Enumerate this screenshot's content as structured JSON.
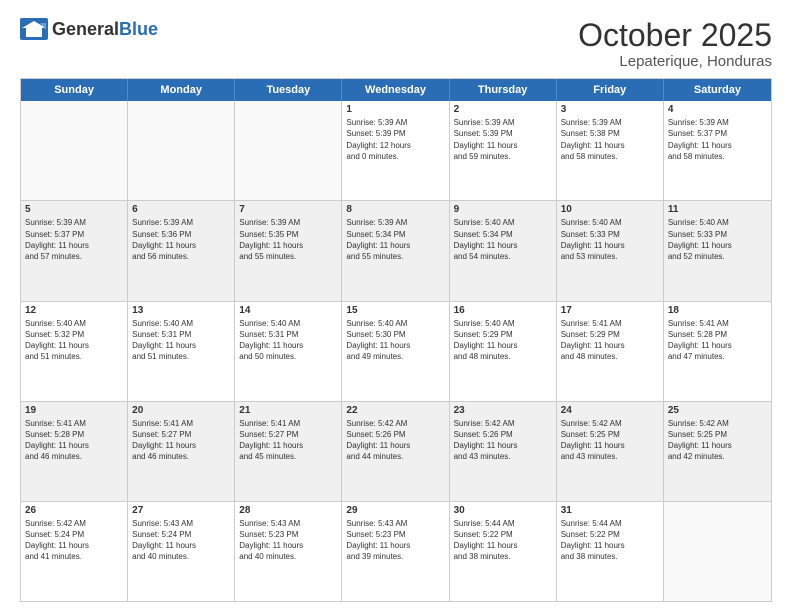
{
  "header": {
    "logo_general": "General",
    "logo_blue": "Blue",
    "month": "October 2025",
    "location": "Lepaterique, Honduras"
  },
  "weekdays": [
    "Sunday",
    "Monday",
    "Tuesday",
    "Wednesday",
    "Thursday",
    "Friday",
    "Saturday"
  ],
  "rows": [
    [
      {
        "day": "",
        "info": ""
      },
      {
        "day": "",
        "info": ""
      },
      {
        "day": "",
        "info": ""
      },
      {
        "day": "1",
        "info": "Sunrise: 5:39 AM\nSunset: 5:39 PM\nDaylight: 12 hours\nand 0 minutes."
      },
      {
        "day": "2",
        "info": "Sunrise: 5:39 AM\nSunset: 5:39 PM\nDaylight: 11 hours\nand 59 minutes."
      },
      {
        "day": "3",
        "info": "Sunrise: 5:39 AM\nSunset: 5:38 PM\nDaylight: 11 hours\nand 58 minutes."
      },
      {
        "day": "4",
        "info": "Sunrise: 5:39 AM\nSunset: 5:37 PM\nDaylight: 11 hours\nand 58 minutes."
      }
    ],
    [
      {
        "day": "5",
        "info": "Sunrise: 5:39 AM\nSunset: 5:37 PM\nDaylight: 11 hours\nand 57 minutes."
      },
      {
        "day": "6",
        "info": "Sunrise: 5:39 AM\nSunset: 5:36 PM\nDaylight: 11 hours\nand 56 minutes."
      },
      {
        "day": "7",
        "info": "Sunrise: 5:39 AM\nSunset: 5:35 PM\nDaylight: 11 hours\nand 55 minutes."
      },
      {
        "day": "8",
        "info": "Sunrise: 5:39 AM\nSunset: 5:34 PM\nDaylight: 11 hours\nand 55 minutes."
      },
      {
        "day": "9",
        "info": "Sunrise: 5:40 AM\nSunset: 5:34 PM\nDaylight: 11 hours\nand 54 minutes."
      },
      {
        "day": "10",
        "info": "Sunrise: 5:40 AM\nSunset: 5:33 PM\nDaylight: 11 hours\nand 53 minutes."
      },
      {
        "day": "11",
        "info": "Sunrise: 5:40 AM\nSunset: 5:33 PM\nDaylight: 11 hours\nand 52 minutes."
      }
    ],
    [
      {
        "day": "12",
        "info": "Sunrise: 5:40 AM\nSunset: 5:32 PM\nDaylight: 11 hours\nand 51 minutes."
      },
      {
        "day": "13",
        "info": "Sunrise: 5:40 AM\nSunset: 5:31 PM\nDaylight: 11 hours\nand 51 minutes."
      },
      {
        "day": "14",
        "info": "Sunrise: 5:40 AM\nSunset: 5:31 PM\nDaylight: 11 hours\nand 50 minutes."
      },
      {
        "day": "15",
        "info": "Sunrise: 5:40 AM\nSunset: 5:30 PM\nDaylight: 11 hours\nand 49 minutes."
      },
      {
        "day": "16",
        "info": "Sunrise: 5:40 AM\nSunset: 5:29 PM\nDaylight: 11 hours\nand 48 minutes."
      },
      {
        "day": "17",
        "info": "Sunrise: 5:41 AM\nSunset: 5:29 PM\nDaylight: 11 hours\nand 48 minutes."
      },
      {
        "day": "18",
        "info": "Sunrise: 5:41 AM\nSunset: 5:28 PM\nDaylight: 11 hours\nand 47 minutes."
      }
    ],
    [
      {
        "day": "19",
        "info": "Sunrise: 5:41 AM\nSunset: 5:28 PM\nDaylight: 11 hours\nand 46 minutes."
      },
      {
        "day": "20",
        "info": "Sunrise: 5:41 AM\nSunset: 5:27 PM\nDaylight: 11 hours\nand 46 minutes."
      },
      {
        "day": "21",
        "info": "Sunrise: 5:41 AM\nSunset: 5:27 PM\nDaylight: 11 hours\nand 45 minutes."
      },
      {
        "day": "22",
        "info": "Sunrise: 5:42 AM\nSunset: 5:26 PM\nDaylight: 11 hours\nand 44 minutes."
      },
      {
        "day": "23",
        "info": "Sunrise: 5:42 AM\nSunset: 5:26 PM\nDaylight: 11 hours\nand 43 minutes."
      },
      {
        "day": "24",
        "info": "Sunrise: 5:42 AM\nSunset: 5:25 PM\nDaylight: 11 hours\nand 43 minutes."
      },
      {
        "day": "25",
        "info": "Sunrise: 5:42 AM\nSunset: 5:25 PM\nDaylight: 11 hours\nand 42 minutes."
      }
    ],
    [
      {
        "day": "26",
        "info": "Sunrise: 5:42 AM\nSunset: 5:24 PM\nDaylight: 11 hours\nand 41 minutes."
      },
      {
        "day": "27",
        "info": "Sunrise: 5:43 AM\nSunset: 5:24 PM\nDaylight: 11 hours\nand 40 minutes."
      },
      {
        "day": "28",
        "info": "Sunrise: 5:43 AM\nSunset: 5:23 PM\nDaylight: 11 hours\nand 40 minutes."
      },
      {
        "day": "29",
        "info": "Sunrise: 5:43 AM\nSunset: 5:23 PM\nDaylight: 11 hours\nand 39 minutes."
      },
      {
        "day": "30",
        "info": "Sunrise: 5:44 AM\nSunset: 5:22 PM\nDaylight: 11 hours\nand 38 minutes."
      },
      {
        "day": "31",
        "info": "Sunrise: 5:44 AM\nSunset: 5:22 PM\nDaylight: 11 hours\nand 38 minutes."
      },
      {
        "day": "",
        "info": ""
      }
    ]
  ]
}
